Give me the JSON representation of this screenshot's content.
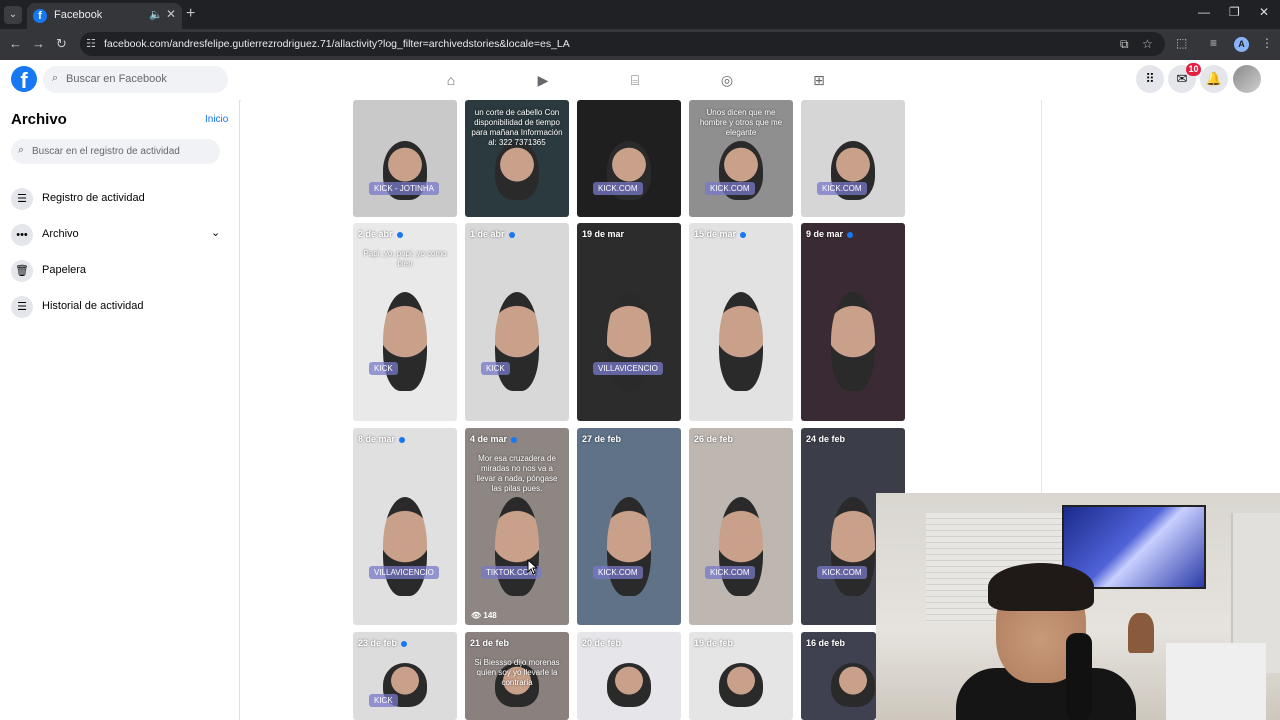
{
  "browser": {
    "tab_title": "Facebook",
    "url": "facebook.com/andresfelipe.gutierrezrodriguez.71/allactivity?log_filter=archivedstories&locale=es_LA",
    "profile_initial": "A",
    "favicon_letter": "f"
  },
  "fb_header": {
    "logo": "f",
    "search_placeholder": "Buscar en Facebook",
    "nav_icons": [
      "home-icon",
      "video-icon",
      "marketplace-icon",
      "groups-icon",
      "gaming-icon"
    ],
    "right_icons": [
      "menu-grid-icon",
      "messenger-icon",
      "bell-icon",
      "avatar"
    ],
    "messenger_badge": "10"
  },
  "sidebar": {
    "title": "Archivo",
    "home_link": "Inicio",
    "search_placeholder": "Buscar en el registro de actividad",
    "items": [
      {
        "label": "Registro de actividad",
        "icon": "list-icon"
      },
      {
        "label": "Archivo",
        "icon": "more-icon",
        "expandable": true
      },
      {
        "label": "Papelera",
        "icon": "trash-icon"
      },
      {
        "label": "Historial de actividad",
        "icon": "list-icon"
      }
    ]
  },
  "grid": {
    "row1": [
      {
        "date": "",
        "dot": false,
        "tag": "KICK - JOTINHA",
        "caption": "",
        "bg": "#c9c9c9"
      },
      {
        "date": "",
        "dot": false,
        "tag": "",
        "caption": "un corte de cabello\nCon disponibilidad de tiempo para mañana\nInformación al: 322 7371365",
        "bg": "#2b3a3f"
      },
      {
        "date": "",
        "dot": false,
        "tag": "KICK.COM",
        "caption": "",
        "bg": "#1f1f1f"
      },
      {
        "date": "",
        "dot": false,
        "tag": "KICK.COM",
        "caption": "Unos dicen que me hombre y otros que me elegante",
        "bg": "#8f8f8f"
      },
      {
        "date": "",
        "dot": false,
        "tag": "KICK.COM",
        "caption": "",
        "bg": "#d6d6d6"
      }
    ],
    "row2": [
      {
        "date": "2 de abr",
        "dot": true,
        "tag": "KICK",
        "caption": "Papi, yo, papi, yo como bien",
        "bg": "#e9e9e9"
      },
      {
        "date": "1 de abr",
        "dot": true,
        "tag": "KICK",
        "caption": "",
        "bg": "#d8d8d8"
      },
      {
        "date": "19 de mar",
        "dot": false,
        "tag": "VILLAVICENCIO",
        "caption": "",
        "bg": "#2c2c2c"
      },
      {
        "date": "15 de mar",
        "dot": true,
        "tag": "",
        "caption": "",
        "bg": "#e2e2e2"
      },
      {
        "date": "9 de mar",
        "dot": true,
        "tag": "",
        "caption": "",
        "bg": "#3a2a33"
      }
    ],
    "row3": [
      {
        "date": "8 de mar",
        "dot": true,
        "tag": "VILLAVICENCIO",
        "caption": "",
        "bg": "#e0e0e0"
      },
      {
        "date": "4 de mar",
        "dot": true,
        "tag": "TIKTOK.COM",
        "caption": "Mor esa cruzadera de miradas no nos va a llevar a nada, póngase las pilas pues.",
        "bg": "#8d8683",
        "views": "148"
      },
      {
        "date": "27 de feb",
        "dot": false,
        "tag": "KICK.COM",
        "caption": "",
        "bg": "#5f7287"
      },
      {
        "date": "26 de feb",
        "dot": false,
        "tag": "KICK.COM",
        "caption": "",
        "bg": "#bdb6b1"
      },
      {
        "date": "24 de feb",
        "dot": false,
        "tag": "KICK.COM",
        "caption": "",
        "bg": "#3b3d49"
      }
    ],
    "row4": [
      {
        "date": "23 de feb",
        "dot": true,
        "tag": "KICK",
        "caption": "",
        "bg": "#dcdcdc"
      },
      {
        "date": "21 de feb",
        "dot": false,
        "tag": "",
        "caption": "Si Biessso dijo morenas quien soy yo llevarle la contraria",
        "bg": "#8a817f"
      },
      {
        "date": "20 de feb",
        "dot": false,
        "tag": "",
        "caption": "",
        "bg": "#e6e6ea"
      },
      {
        "date": "19 de feb",
        "dot": false,
        "tag": "",
        "caption": "",
        "bg": "#e5e5e5"
      },
      {
        "date": "16 de feb",
        "dot": false,
        "tag": "",
        "caption": "",
        "bg": "#3f4150"
      }
    ]
  },
  "colors": {
    "fb_blue": "#1877f2",
    "badge_red": "#e41e3f",
    "chrome_dark": "#202124",
    "chrome_toolbar": "#35363a",
    "page_bg": "#ffffff"
  }
}
